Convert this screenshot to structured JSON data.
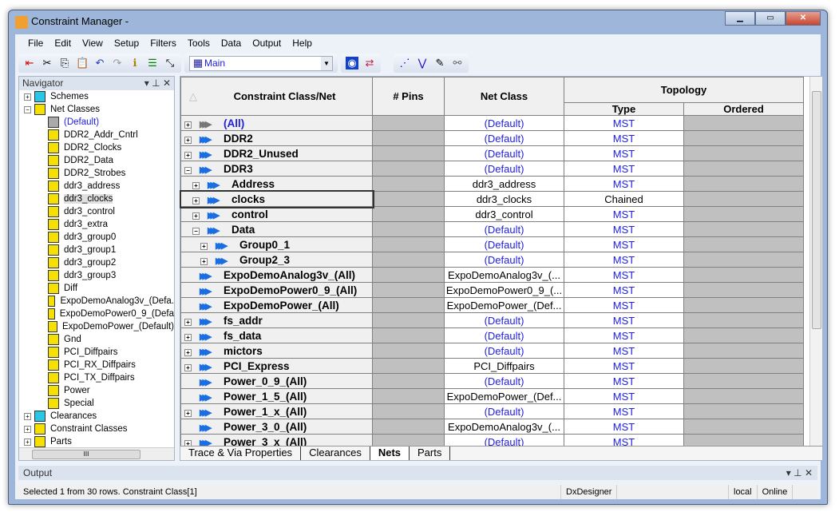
{
  "window": {
    "title": "Constraint Manager -"
  },
  "menu": [
    "File",
    "Edit",
    "View",
    "Setup",
    "Filters",
    "Tools",
    "Data",
    "Output",
    "Help"
  ],
  "toolbar": {
    "sheet_combo": "Main"
  },
  "navigator": {
    "title": "Navigator",
    "items": [
      {
        "label": "Schemes",
        "level": 0,
        "exp": "+",
        "icon": "c"
      },
      {
        "label": "Net Classes",
        "level": 0,
        "exp": "-",
        "icon": "w"
      },
      {
        "label": "(Default)",
        "level": 1,
        "icon": "g",
        "blue": true
      },
      {
        "label": "DDR2_Addr_Cntrl",
        "level": 1
      },
      {
        "label": "DDR2_Clocks",
        "level": 1
      },
      {
        "label": "DDR2_Data",
        "level": 1
      },
      {
        "label": "DDR2_Strobes",
        "level": 1
      },
      {
        "label": "ddr3_address",
        "level": 1
      },
      {
        "label": "ddr3_clocks",
        "level": 1,
        "selected": true
      },
      {
        "label": "ddr3_control",
        "level": 1
      },
      {
        "label": "ddr3_extra",
        "level": 1
      },
      {
        "label": "ddr3_group0",
        "level": 1
      },
      {
        "label": "ddr3_group1",
        "level": 1
      },
      {
        "label": "ddr3_group2",
        "level": 1
      },
      {
        "label": "ddr3_group3",
        "level": 1
      },
      {
        "label": "Diff",
        "level": 1
      },
      {
        "label": "ExpoDemoAnalog3v_(Defa.",
        "level": 1
      },
      {
        "label": "ExpoDemoPower0_9_(Defa",
        "level": 1
      },
      {
        "label": "ExpoDemoPower_(Default)",
        "level": 1
      },
      {
        "label": "Gnd",
        "level": 1
      },
      {
        "label": "PCI_Diffpairs",
        "level": 1
      },
      {
        "label": "PCI_RX_Diffpairs",
        "level": 1
      },
      {
        "label": "PCI_TX_Diffpairs",
        "level": 1
      },
      {
        "label": "Power",
        "level": 1
      },
      {
        "label": "Special",
        "level": 1
      },
      {
        "label": "Clearances",
        "level": 0,
        "exp": "+",
        "icon": "c"
      },
      {
        "label": "Constraint Classes",
        "level": 0,
        "exp": "+",
        "icon": "w"
      },
      {
        "label": "Parts",
        "level": 0,
        "exp": "+",
        "icon": "w"
      }
    ]
  },
  "grid": {
    "headers": {
      "name": "Constraint Class/Net",
      "pins": "# Pins",
      "netclass": "Net Class",
      "topology": "Topology",
      "type": "Type",
      "ordered": "Ordered"
    },
    "rows": [
      {
        "name": "(All)",
        "level": 0,
        "exp": "+",
        "netclass": "(Default)",
        "type": "MST",
        "blue": true
      },
      {
        "name": "DDR2",
        "level": 0,
        "exp": "+",
        "netclass": "(Default)",
        "type": "MST"
      },
      {
        "name": "DDR2_Unused",
        "level": 0,
        "exp": "+",
        "netclass": "(Default)",
        "type": "MST"
      },
      {
        "name": "DDR3",
        "level": 0,
        "exp": "-",
        "netclass": "(Default)",
        "type": "MST"
      },
      {
        "name": "Address",
        "level": 1,
        "exp": "+",
        "netclass": "ddr3_address",
        "type": "MST"
      },
      {
        "name": "clocks",
        "level": 1,
        "exp": "+",
        "netclass": "ddr3_clocks",
        "type": "Chained",
        "selected": true
      },
      {
        "name": "control",
        "level": 1,
        "exp": "+",
        "netclass": "ddr3_control",
        "type": "MST"
      },
      {
        "name": "Data",
        "level": 1,
        "exp": "-",
        "netclass": "(Default)",
        "type": "MST"
      },
      {
        "name": "Group0_1",
        "level": 2,
        "exp": "+",
        "netclass": "(Default)",
        "type": "MST"
      },
      {
        "name": "Group2_3",
        "level": 2,
        "exp": "+",
        "netclass": "(Default)",
        "type": "MST"
      },
      {
        "name": "ExpoDemoAnalog3v_(All)",
        "level": 0,
        "netclass": "ExpoDemoAnalog3v_(...",
        "type": "MST"
      },
      {
        "name": "ExpoDemoPower0_9_(All)",
        "level": 0,
        "netclass": "ExpoDemoPower0_9_(...",
        "type": "MST"
      },
      {
        "name": "ExpoDemoPower_(All)",
        "level": 0,
        "netclass": "ExpoDemoPower_(Def...",
        "type": "MST"
      },
      {
        "name": "fs_addr",
        "level": 0,
        "exp": "+",
        "netclass": "(Default)",
        "type": "MST"
      },
      {
        "name": "fs_data",
        "level": 0,
        "exp": "+",
        "netclass": "(Default)",
        "type": "MST"
      },
      {
        "name": "mictors",
        "level": 0,
        "exp": "+",
        "netclass": "(Default)",
        "type": "MST"
      },
      {
        "name": "PCI_Express",
        "level": 0,
        "exp": "+",
        "netclass": "PCI_Diffpairs",
        "type": "MST"
      },
      {
        "name": "Power_0_9_(All)",
        "level": 0,
        "netclass": "(Default)",
        "type": "MST"
      },
      {
        "name": "Power_1_5_(All)",
        "level": 0,
        "netclass": "ExpoDemoPower_(Def...",
        "type": "MST"
      },
      {
        "name": "Power_1_x_(All)",
        "level": 0,
        "exp": "+",
        "netclass": "(Default)",
        "type": "MST"
      },
      {
        "name": "Power_3_0_(All)",
        "level": 0,
        "netclass": "ExpoDemoAnalog3v_(...",
        "type": "MST"
      },
      {
        "name": "Power_3_x_(All)",
        "level": 0,
        "exp": "+",
        "netclass": "(Default)",
        "type": "MST"
      }
    ],
    "tabs": [
      "Trace & Via Properties",
      "Clearances",
      "Nets",
      "Parts"
    ],
    "active_tab": "Nets"
  },
  "output": {
    "title": "Output"
  },
  "status": {
    "message": "Selected 1 from 30 rows. Constraint Class[1]",
    "app": "DxDesigner",
    "mode": "local",
    "connection": "Online"
  }
}
